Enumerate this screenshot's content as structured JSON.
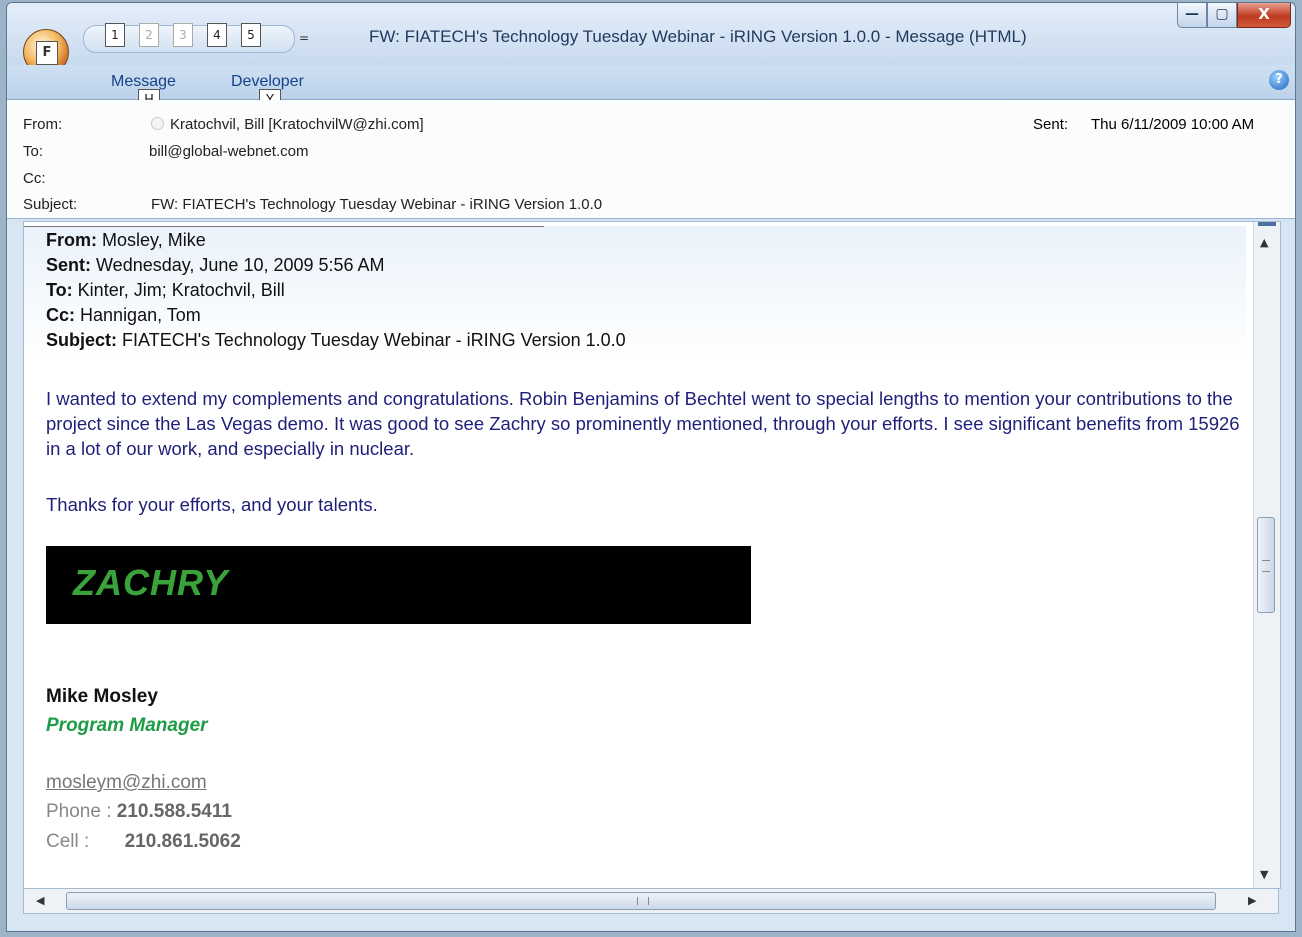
{
  "window": {
    "title": "FW: FIATECH's Technology Tuesday Webinar - iRING Version 1.0.0 - Message (HTML)",
    "office_key": "F",
    "qat_keys": [
      "1",
      "2",
      "3",
      "4",
      "5"
    ],
    "qat_more": "=",
    "minimize": "—",
    "maximize": "▢",
    "close": "X"
  },
  "ribbon": {
    "tabs": [
      {
        "label": "Message",
        "key": "H"
      },
      {
        "label": "Developer",
        "key": "Y"
      }
    ],
    "help": "?"
  },
  "header": {
    "from_label": "From:",
    "from_value": "Kratochvil, Bill [KratochvilW@zhi.com]",
    "to_label": "To:",
    "to_value": "bill@global-webnet.com",
    "cc_label": "Cc:",
    "cc_value": "",
    "subject_label": "Subject:",
    "subject_value": "FW: FIATECH's Technology Tuesday Webinar - iRING Version 1.0.0",
    "sent_label": "Sent:",
    "sent_value": "Thu 6/11/2009 10:00 AM"
  },
  "forwarded": {
    "from_label": "From:",
    "from_value": "Mosley, Mike",
    "sent_label": "Sent:",
    "sent_value": "Wednesday, June 10, 2009 5:56 AM",
    "to_label": "To:",
    "to_value": "Kinter, Jim; Kratochvil, Bill",
    "cc_label": "Cc:",
    "cc_value": "Hannigan, Tom",
    "subject_label": "Subject:",
    "subject_value": "FIATECH's Technology Tuesday Webinar - iRING Version 1.0.0"
  },
  "body": {
    "paragraph1": "I wanted to extend my complements and congratulations. Robin Benjamins of Bechtel went to special lengths to mention your contributions to the project since the Las Vegas demo. It was good to see Zachry so prominently mentioned, through your efforts. I see significant benefits from 15926 in a lot of our work, and especially in nuclear.",
    "paragraph2": "Thanks for your efforts, and your talents."
  },
  "signature": {
    "logo_text": "ZACHRY",
    "name": "Mike Mosley",
    "title": "Program Manager",
    "email": "mosleym@zhi.com",
    "phone_label": "Phone :",
    "phone_value": "210.588.5411",
    "cell_label": "Cell :",
    "cell_value": "210.861.5062"
  },
  "scrollbars": {
    "up": "▲",
    "down": "▼",
    "left": "◀",
    "right": "▶"
  }
}
